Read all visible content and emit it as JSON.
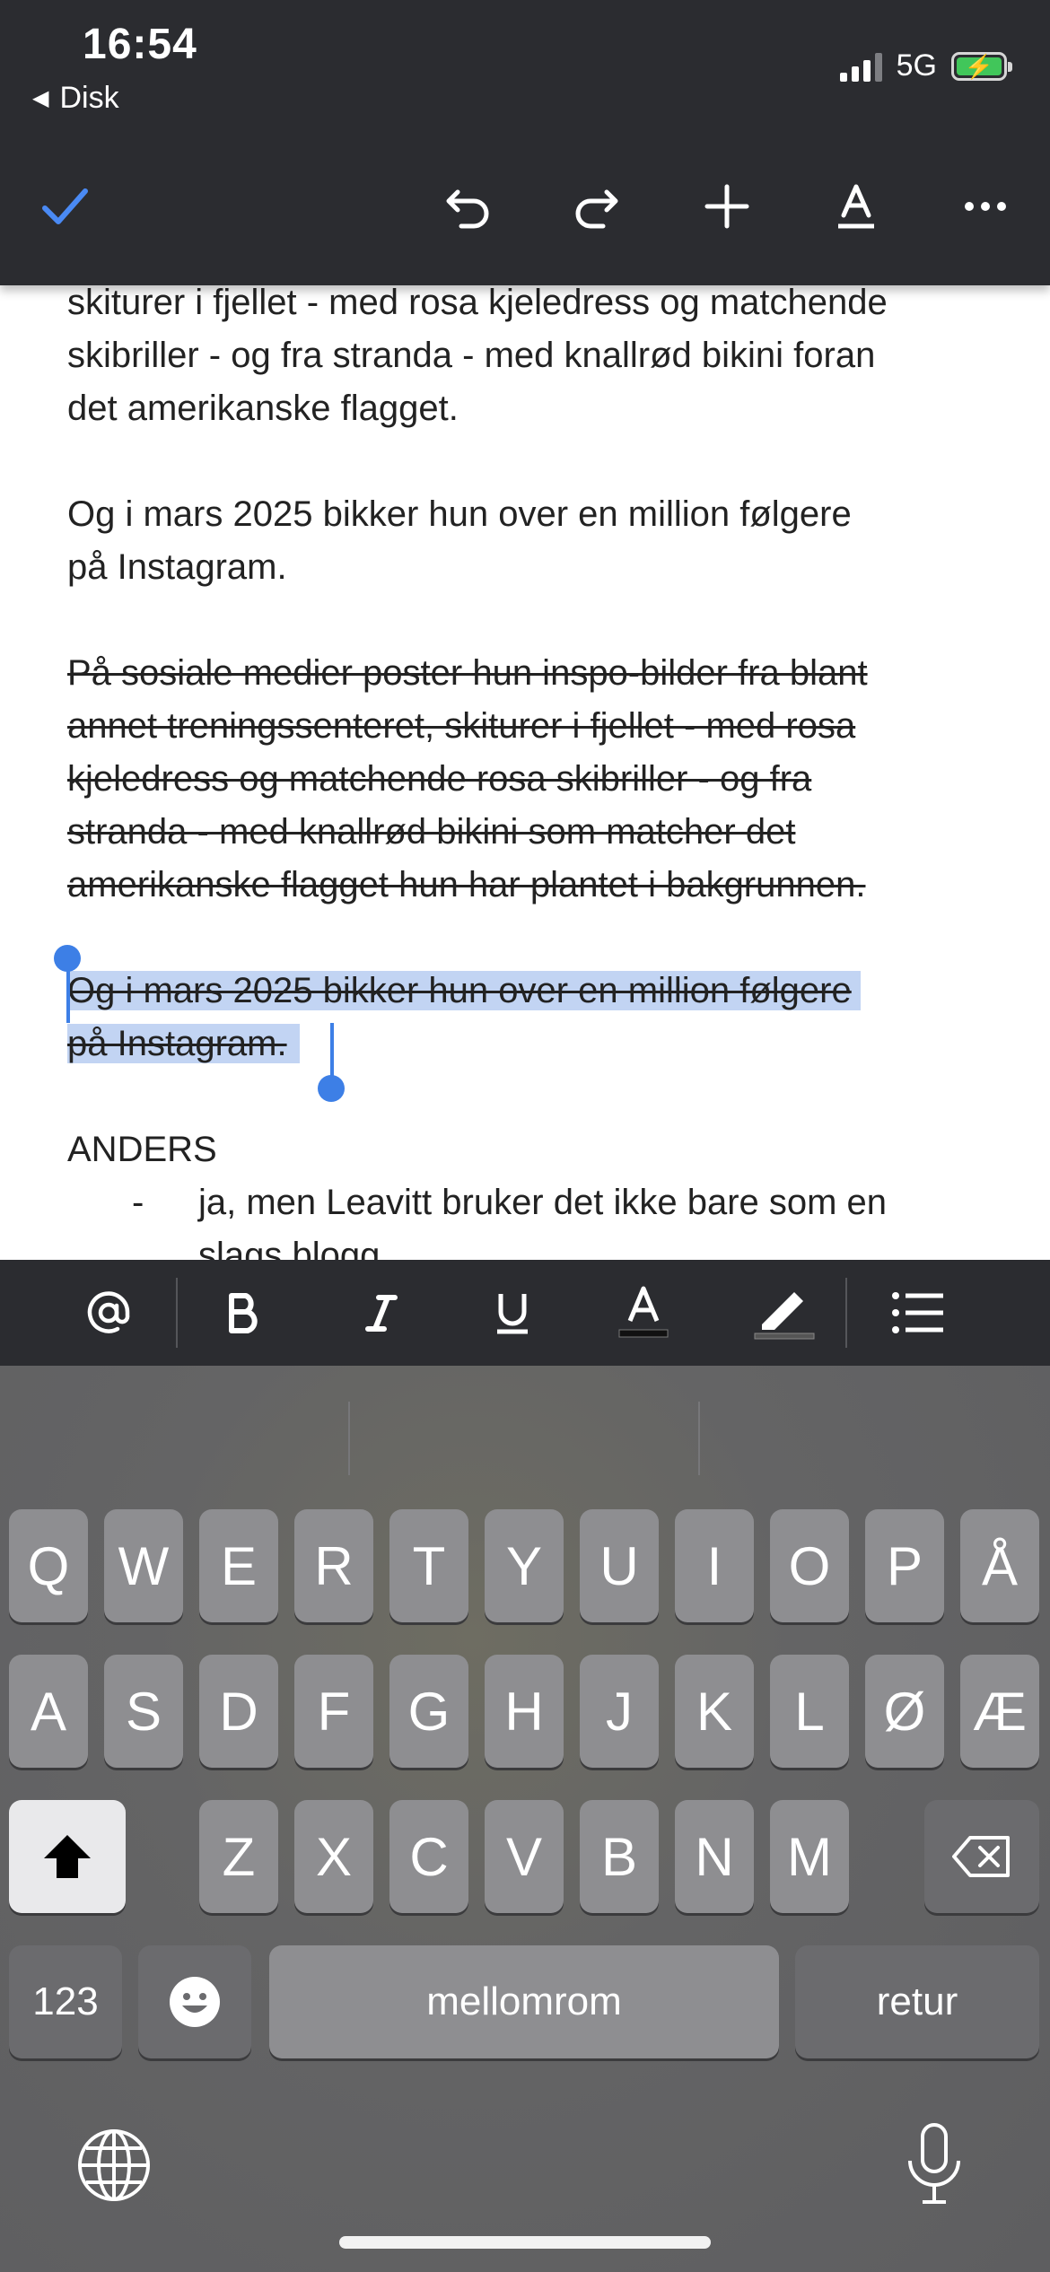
{
  "status_bar": {
    "time": "16:54",
    "back_app": "Disk",
    "network": "5G"
  },
  "toolbar": {
    "icons": [
      "check-icon",
      "undo-icon",
      "redo-icon",
      "plus-icon",
      "text-format-icon",
      "more-icon"
    ],
    "accent": "#4a8af4"
  },
  "document": {
    "p1": "skiturer i fjellet - med rosa kjeledress og matchende skibriller - og fra stranda - med knallrød bikini foran det amerikanske flagget.",
    "p1_lines": [
      "skiturer i fjellet - med rosa kjeledress og matchende",
      "skibriller - og fra stranda - med knallrød bikini foran",
      "det amerikanske flagget."
    ],
    "p2_lines": [
      "Og i mars 2025 bikker hun over en million følgere",
      "på Instagram."
    ],
    "p3_lines": [
      "På sosiale medier poster hun inspo-bilder fra blant",
      "annet treningssenteret, skiturer i fjellet - med rosa",
      "kjeledress og matchende rosa skibriller - og fra",
      "stranda - med knallrød bikini som matcher det",
      "amerikanske flagget hun har plantet i bakgrunnen."
    ],
    "p4_lines": [
      "Og i mars 2025 bikker hun over en million følgere",
      "på Instagram."
    ],
    "speaker": "ANDERS",
    "bullet_dash": "-",
    "bullet_lines": [
      "ja, men Leavitt bruker det ikke bare som en",
      "slags blogg"
    ],
    "selection_color": "#c2d4f3"
  },
  "format_bar": {
    "icons": [
      "mention-icon",
      "bold-icon",
      "italic-icon",
      "underline-icon",
      "text-color-icon",
      "highlight-icon",
      "bullet-list-icon"
    ]
  },
  "keyboard": {
    "row1": [
      "Q",
      "W",
      "E",
      "R",
      "T",
      "Y",
      "U",
      "I",
      "O",
      "P",
      "Å"
    ],
    "row2": [
      "A",
      "S",
      "D",
      "F",
      "G",
      "H",
      "J",
      "K",
      "L",
      "Ø",
      "Æ"
    ],
    "row3": [
      "Z",
      "X",
      "C",
      "V",
      "B",
      "N",
      "M"
    ],
    "numbers_key": "123",
    "space_key": "mellomrom",
    "return_key": "retur"
  }
}
